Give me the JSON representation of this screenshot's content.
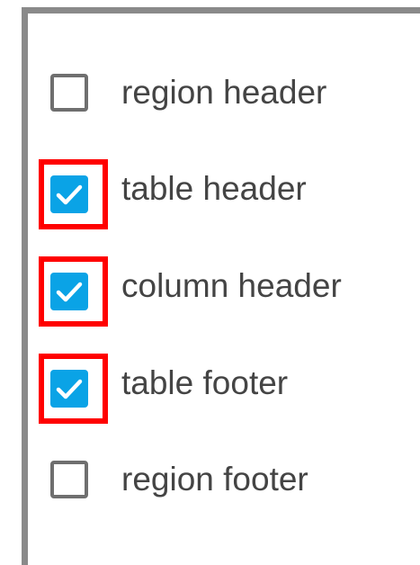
{
  "options": [
    {
      "label": "region header",
      "checked": false,
      "highlighted": false
    },
    {
      "label": "table header",
      "checked": true,
      "highlighted": true
    },
    {
      "label": "column header",
      "checked": true,
      "highlighted": true
    },
    {
      "label": "table footer",
      "checked": true,
      "highlighted": true
    },
    {
      "label": "region footer",
      "checked": false,
      "highlighted": false
    }
  ],
  "colors": {
    "checkbox_checked": "#0aa3e6",
    "checkbox_unchecked_border": "#6f6f6f",
    "highlight": "#ff0000",
    "label_text": "#444444",
    "panel_border": "#8a8a8a"
  }
}
